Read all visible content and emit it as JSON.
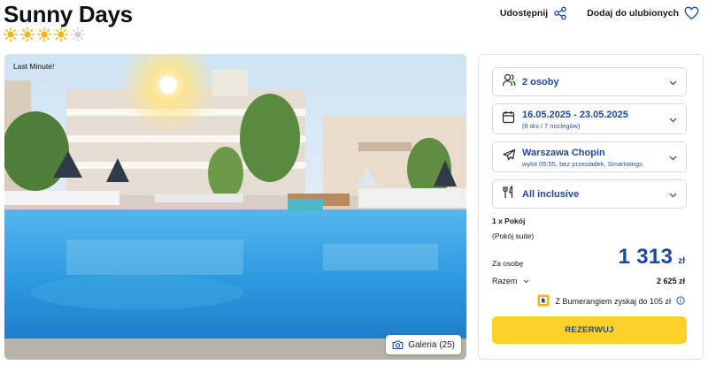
{
  "hotel": {
    "name": "Sunny Days",
    "rating": {
      "value": 4,
      "max": 5,
      "icon": "sun-icon",
      "filled_color": "#f5b50a",
      "empty_color": "#d0d0d0"
    }
  },
  "actions": {
    "share_label": "Udostępnij",
    "share_icon": "share-icon",
    "favorite_label": "Dodaj do ulubionych",
    "favorite_icon": "heart-icon"
  },
  "gallery": {
    "badge": "Last Minute!",
    "button_label": "Galeria (25)",
    "button_icon": "camera-icon"
  },
  "booking": {
    "guests": {
      "label": "2 osoby",
      "icon": "person-icon"
    },
    "dates": {
      "label": "16.05.2025 - 23.05.2025",
      "sub": "(8 dni / 7 noclegów)",
      "icon": "calendar-icon"
    },
    "departure": {
      "label": "Warszawa Chopin",
      "sub": "wylot 05:55, bez przesiadek, Smartwings",
      "icon": "plane-icon"
    },
    "board": {
      "label": "All inclusive",
      "icon": "fork-knife-icon"
    },
    "room_count": "1 x Pokój",
    "room_type": "(Pokój suite)",
    "per_person_label": "Za osobę",
    "per_person_price": "1 313",
    "currency": "zł",
    "total_label": "Razem",
    "total_value": "2 625 zł",
    "bumerang_text": "Z Bumerangiem zyskaj do 105 zł",
    "reserve_label": "REZERWUJ"
  },
  "colors": {
    "brand_blue": "#1c4a9a",
    "reserve_yellow": "#fcd12a",
    "pool_blue": "#2f9be0"
  }
}
